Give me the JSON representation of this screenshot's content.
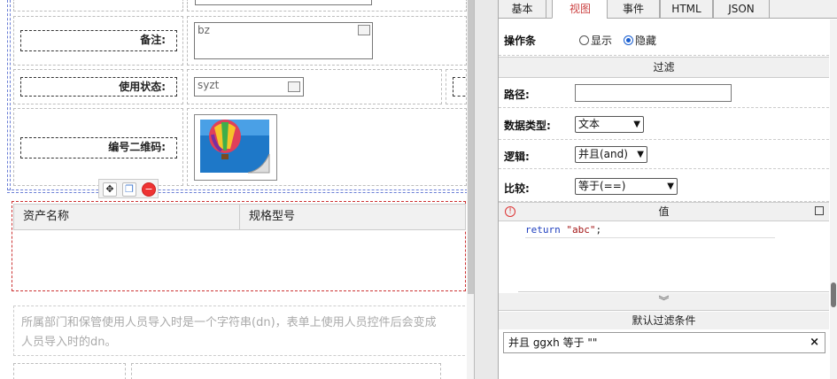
{
  "left": {
    "remark": {
      "label": "备注:",
      "value": "bz"
    },
    "status": {
      "label": "使用状态:",
      "value": "syzt"
    },
    "qrcode": {
      "label": "编号二维码:"
    },
    "table": {
      "columns": [
        "资产名称",
        "规格型号"
      ]
    },
    "note": {
      "lines": [
        "所属部门和保管使用人员导入时是一个字符串(dn)，表单上使用人员控件后会变成",
        "人员导入时的dn。"
      ]
    }
  },
  "right": {
    "tabs": [
      {
        "label": "基本",
        "active": false
      },
      {
        "label": "视图",
        "active": true
      },
      {
        "label": "事件",
        "active": false
      },
      {
        "label": "HTML",
        "active": false
      },
      {
        "label": "JSON",
        "active": false
      }
    ],
    "toolbar_row": {
      "label": "操作条",
      "options": [
        "显示",
        "隐藏"
      ],
      "selected": "隐藏"
    },
    "filter_section": "过滤",
    "path": {
      "label": "路径:",
      "value": ""
    },
    "datatype": {
      "label": "数据类型:",
      "value": "文本"
    },
    "logic": {
      "label": "逻辑:",
      "value": "并且(and)"
    },
    "compare": {
      "label": "比较:",
      "value": "等于(==)"
    },
    "value_section": "值",
    "code": {
      "keyword": "return",
      "string": "\"abc\"",
      "end": ";"
    },
    "default_section": "默认过滤条件",
    "default_filter": "并且 ggxh 等于 \"\"",
    "close_glyph": "×"
  },
  "colors": {
    "accent": "#c44444",
    "radio": "#1a5fd0"
  }
}
